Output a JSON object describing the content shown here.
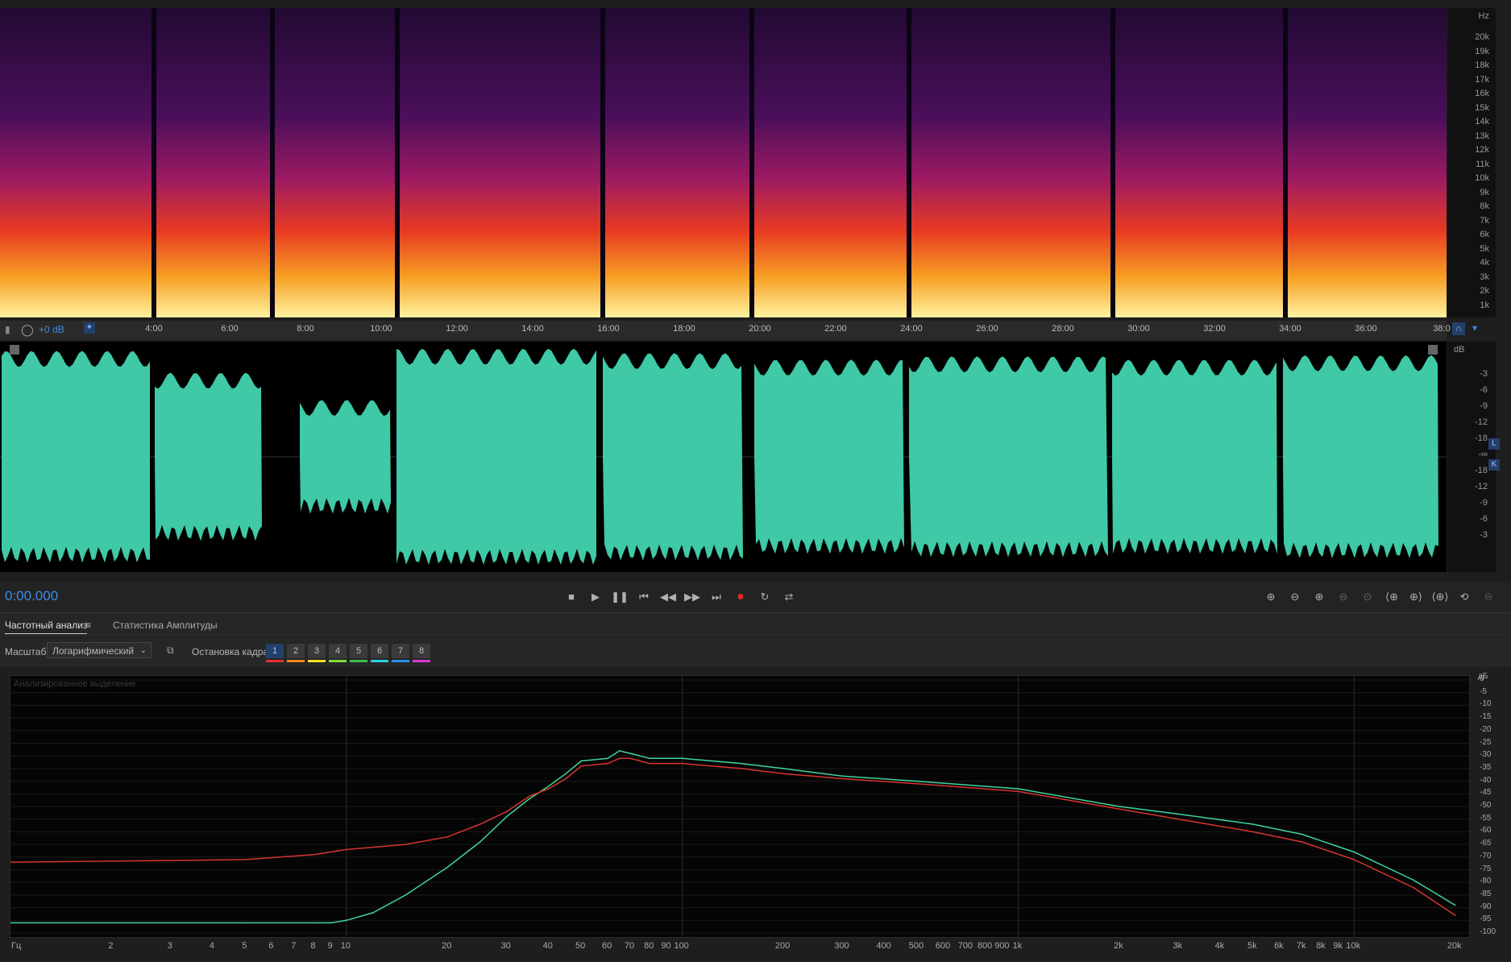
{
  "spectrogram": {
    "unit_label": "Hz",
    "freq_labels": [
      "20k",
      "19k",
      "18k",
      "17k",
      "16k",
      "15k",
      "14k",
      "13k",
      "12k",
      "11k",
      "10k",
      "9k",
      "8k",
      "7k",
      "6k",
      "5k",
      "4k",
      "3k",
      "2k",
      "1k"
    ]
  },
  "ruler": {
    "volume": "+0 dB",
    "time_labels": [
      "4:00",
      "6:00",
      "8:00",
      "10:00",
      "12:00",
      "14:00",
      "16:00",
      "18:00",
      "20:00",
      "22:00",
      "24:00",
      "26:00",
      "28:00",
      "30:00",
      "32:00",
      "34:00",
      "36:00",
      "38:0"
    ]
  },
  "waveform": {
    "unit_label": "dB",
    "db_labels": [
      "-3",
      "-6",
      "-9",
      "-12",
      "-18",
      "-∞",
      "-18",
      "-12",
      "-9",
      "-6",
      "-3"
    ],
    "channel_top": "L",
    "channel_bottom": "K",
    "colors": {
      "fill": "#3fc9a6",
      "background": "#000000"
    }
  },
  "transport": {
    "timecode": "0:00.000",
    "buttons": [
      "stop",
      "play",
      "pause",
      "go-to-start",
      "rewind",
      "fast-forward",
      "go-to-end",
      "record",
      "loop",
      "skip-selection"
    ],
    "zoom_buttons": [
      "zoom-in-amplitude",
      "zoom-out-amplitude",
      "zoom-in-time",
      "zoom-out-time",
      "zoom-full",
      "zoom-in-left",
      "zoom-in-right",
      "zoom-to-selection",
      "zoom-reset",
      "zoom-out-full"
    ],
    "record_color": "#e02828"
  },
  "panel": {
    "tabs": [
      "Частотный анализ",
      "Статистика Амплитуды"
    ],
    "scale_label": "Масштаб:",
    "scale_value": "Логарифмический",
    "freeze_label": "Остановка кадра:",
    "frames": [
      "1",
      "2",
      "3",
      "4",
      "5",
      "6",
      "7",
      "8"
    ],
    "frame_colors": [
      "#e33131",
      "#f08a24",
      "#f0e02a",
      "#7de03a",
      "#3bbf4e",
      "#2bd3e0",
      "#2f8ff0",
      "#d63ad6"
    ],
    "plot_title": "Анализированное выделение",
    "y_unit": "дБ",
    "y_labels": [
      "0",
      "-5",
      "-10",
      "-15",
      "-20",
      "-25",
      "-30",
      "-35",
      "-40",
      "-45",
      "-50",
      "-55",
      "-60",
      "-65",
      "-70",
      "-75",
      "-80",
      "-85",
      "-90",
      "-95",
      "-100"
    ],
    "x_unit": "Гц",
    "x_labels": [
      "2",
      "3",
      "4",
      "5",
      "6",
      "7",
      "8",
      "9",
      "10",
      "20",
      "30",
      "40",
      "50",
      "60",
      "70",
      "80",
      "90",
      "100",
      "200",
      "300",
      "400",
      "500",
      "600",
      "700",
      "800",
      "900",
      "1k",
      "2k",
      "3k",
      "4k",
      "5k",
      "6k",
      "7k",
      "8k",
      "9k",
      "10k",
      "20k"
    ]
  },
  "chart_data": {
    "type": "line",
    "xlabel": "Гц",
    "ylabel": "дБ",
    "xscale": "log",
    "xlim": [
      1,
      22000
    ],
    "ylim": [
      -100,
      0
    ],
    "series": [
      {
        "color": "#3fd49a",
        "x": [
          1,
          5,
          8,
          9,
          10,
          12,
          15,
          20,
          25,
          30,
          35,
          40,
          45,
          50,
          60,
          65,
          70,
          80,
          100,
          150,
          200,
          300,
          500,
          1000,
          2000,
          3000,
          5000,
          7000,
          10000,
          15000,
          20000
        ],
        "values": [
          -96,
          -96,
          -96,
          -96,
          -95,
          -92,
          -85,
          -74,
          -64,
          -54,
          -47,
          -42,
          -37,
          -32,
          -31,
          -28,
          -29,
          -31,
          -31,
          -33,
          -35,
          -38,
          -40,
          -43,
          -50,
          -53,
          -57,
          -61,
          -68,
          -79,
          -89
        ]
      },
      {
        "color": "#d8342e",
        "x": [
          1,
          5,
          8,
          10,
          15,
          20,
          25,
          30,
          35,
          40,
          45,
          50,
          60,
          65,
          70,
          80,
          100,
          150,
          200,
          300,
          500,
          1000,
          2000,
          3000,
          5000,
          7000,
          10000,
          15000,
          20000
        ],
        "values": [
          -72,
          -71,
          -69,
          -67,
          -65,
          -62,
          -57,
          -52,
          -46,
          -43,
          -39,
          -34,
          -33,
          -31,
          -31,
          -33,
          -33,
          -35,
          -37,
          -39,
          -41,
          -44,
          -51,
          -55,
          -60,
          -64,
          -71,
          -82,
          -93
        ]
      }
    ]
  }
}
